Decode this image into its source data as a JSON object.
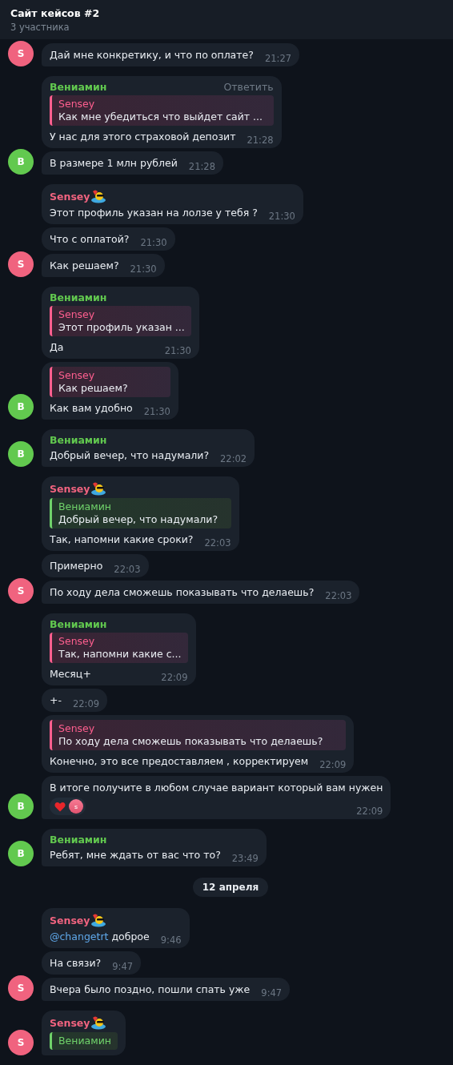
{
  "header": {
    "title": "Сайт кейсов #2",
    "subtitle": "3 участника"
  },
  "feed": [
    {
      "kind": "group",
      "color": "#f0637f",
      "avatar": "S",
      "messages": [
        {
          "text": "Дай мне конкретику, и что по оплате?",
          "time": "21:27"
        }
      ]
    },
    {
      "kind": "group",
      "color": "#62c94f",
      "avatar": "В",
      "messages": [
        {
          "name": "Вениамин",
          "action": "Ответить",
          "reply": {
            "kind": "sensey",
            "name": "Sensey",
            "text": "Как мне убедиться что выйдет сайт ..."
          },
          "text": "У нас для этого страховой депозит",
          "time": "21:28"
        },
        {
          "text": "В размере 1 млн рублей",
          "time": "21:28"
        }
      ]
    },
    {
      "kind": "group",
      "color": "#f0637f",
      "avatar": "S",
      "messages": [
        {
          "name": "Sensey",
          "name_emoji": true,
          "text": "Этот профиль указан на лолзе у тебя ?",
          "time": "21:30"
        },
        {
          "text": "Что с оплатой?",
          "time": "21:30"
        },
        {
          "text": "Как решаем?",
          "time": "21:30"
        }
      ]
    },
    {
      "kind": "group",
      "color": "#62c94f",
      "avatar": "В",
      "messages": [
        {
          "name": "Вениамин",
          "reply": {
            "kind": "sensey",
            "name": "Sensey",
            "text": "Этот профиль указан ..."
          },
          "text": "Да",
          "time": "21:30"
        },
        {
          "reply": {
            "kind": "sensey",
            "name": "Sensey",
            "text": "Как решаем?"
          },
          "text": "Как вам удобно",
          "time": "21:30"
        }
      ]
    },
    {
      "kind": "group",
      "color": "#62c94f",
      "avatar": "В",
      "messages": [
        {
          "name": "Вениамин",
          "text": "Добрый вечер, что надумали?",
          "time": "22:02"
        }
      ]
    },
    {
      "kind": "group",
      "color": "#f0637f",
      "avatar": "S",
      "messages": [
        {
          "name": "Sensey",
          "name_emoji": true,
          "reply": {
            "kind": "veniamin",
            "name": "Вениамин",
            "text": "Добрый вечер, что надумали?"
          },
          "text": "Так, напомни какие сроки?",
          "time": "22:03"
        },
        {
          "text": "Примерно",
          "time": "22:03"
        },
        {
          "text": "По ходу дела сможешь показывать что делаешь?",
          "time": "22:03"
        }
      ]
    },
    {
      "kind": "group",
      "color": "#62c94f",
      "avatar": "В",
      "messages": [
        {
          "name": "Вениамин",
          "reply": {
            "kind": "sensey",
            "name": "Sensey",
            "text": "Так, напомни какие с..."
          },
          "text": "Месяц+",
          "time": "22:09"
        },
        {
          "text": "+-",
          "time": "22:09"
        },
        {
          "reply": {
            "kind": "sensey",
            "name": "Sensey",
            "text": "По ходу дела сможешь показывать что делаешь?"
          },
          "text": "Конечно, это все предоставляем , корректируем",
          "time": "22:09"
        },
        {
          "text": "В итоге получите в любом случае вариант который вам нужен",
          "time": "22:09",
          "reaction": {
            "kind": "heart",
            "avatar": "s"
          }
        }
      ]
    },
    {
      "kind": "group",
      "color": "#62c94f",
      "avatar": "В",
      "messages": [
        {
          "name": "Вениамин",
          "text": "Ребят, мне ждать от вас что то?",
          "time": "23:49"
        }
      ]
    },
    {
      "kind": "date",
      "label": "12 апреля"
    },
    {
      "kind": "group",
      "color": "#f0637f",
      "avatar": "S",
      "messages": [
        {
          "name": "Sensey",
          "name_emoji": true,
          "mention": "@changetrt",
          "text": "доброе",
          "time": "9:46"
        },
        {
          "text": "На связи?",
          "time": "9:47"
        },
        {
          "text": "Вчера было поздно, пошли спать уже",
          "time": "9:47"
        }
      ]
    },
    {
      "kind": "group",
      "color": "#f0637f",
      "avatar": "S",
      "messages": [
        {
          "name": "Sensey",
          "name_emoji": true,
          "reply": {
            "kind": "veniamin",
            "name": "Вениамин"
          }
        }
      ]
    }
  ]
}
